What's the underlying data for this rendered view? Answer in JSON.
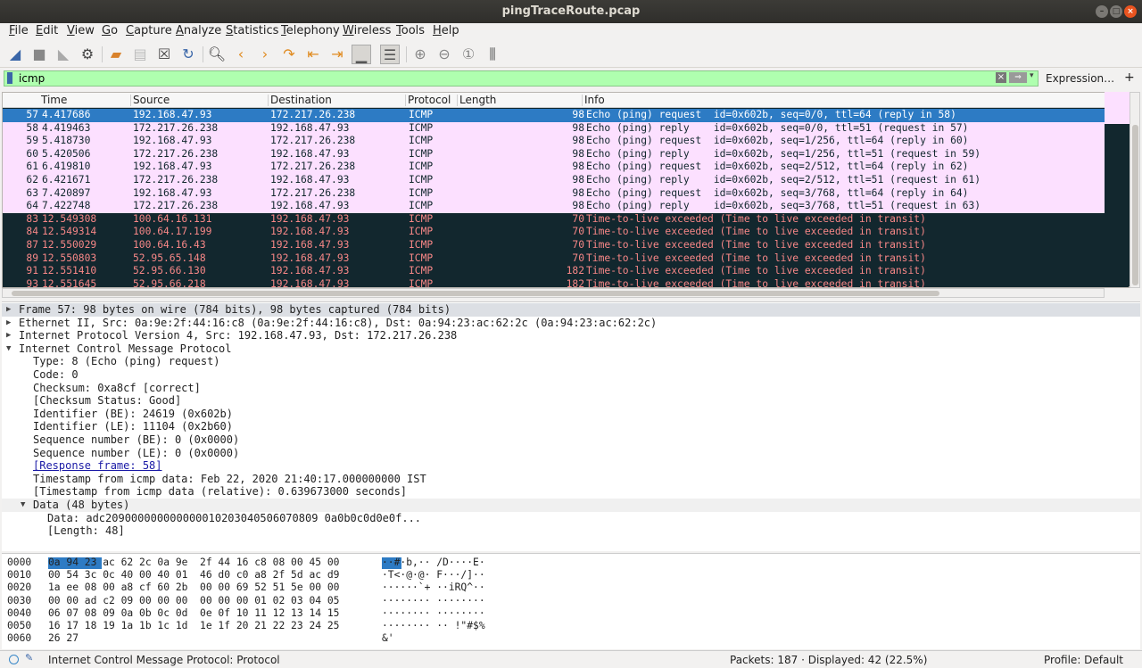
{
  "window": {
    "title": "pingTraceRoute.pcap"
  },
  "menu": [
    "File",
    "Edit",
    "View",
    "Go",
    "Capture",
    "Analyze",
    "Statistics",
    "Telephony",
    "Wireless",
    "Tools",
    "Help"
  ],
  "filter": {
    "value": "icmp",
    "expression_label": "Expression…",
    "add_label": "+"
  },
  "columns": [
    "Time",
    "Source",
    "Destination",
    "Protocol",
    "Length",
    "Info"
  ],
  "packets": [
    {
      "no": "57",
      "time": "4.417686",
      "src": "192.168.47.93",
      "dst": "172.217.26.238",
      "proto": "ICMP",
      "len": "98",
      "info": "Echo (ping) request  id=0x602b, seq=0/0, ttl=64 (reply in 58)",
      "style": "sel"
    },
    {
      "no": "58",
      "time": "4.419463",
      "src": "172.217.26.238",
      "dst": "192.168.47.93",
      "proto": "ICMP",
      "len": "98",
      "info": "Echo (ping) reply    id=0x602b, seq=0/0, ttl=51 (request in 57)",
      "style": "pink"
    },
    {
      "no": "59",
      "time": "5.418730",
      "src": "192.168.47.93",
      "dst": "172.217.26.238",
      "proto": "ICMP",
      "len": "98",
      "info": "Echo (ping) request  id=0x602b, seq=1/256, ttl=64 (reply in 60)",
      "style": "pink"
    },
    {
      "no": "60",
      "time": "5.420506",
      "src": "172.217.26.238",
      "dst": "192.168.47.93",
      "proto": "ICMP",
      "len": "98",
      "info": "Echo (ping) reply    id=0x602b, seq=1/256, ttl=51 (request in 59)",
      "style": "pink"
    },
    {
      "no": "61",
      "time": "6.419810",
      "src": "192.168.47.93",
      "dst": "172.217.26.238",
      "proto": "ICMP",
      "len": "98",
      "info": "Echo (ping) request  id=0x602b, seq=2/512, ttl=64 (reply in 62)",
      "style": "pink"
    },
    {
      "no": "62",
      "time": "6.421671",
      "src": "172.217.26.238",
      "dst": "192.168.47.93",
      "proto": "ICMP",
      "len": "98",
      "info": "Echo (ping) reply    id=0x602b, seq=2/512, ttl=51 (request in 61)",
      "style": "pink"
    },
    {
      "no": "63",
      "time": "7.420897",
      "src": "192.168.47.93",
      "dst": "172.217.26.238",
      "proto": "ICMP",
      "len": "98",
      "info": "Echo (ping) request  id=0x602b, seq=3/768, ttl=64 (reply in 64)",
      "style": "pink"
    },
    {
      "no": "64",
      "time": "7.422748",
      "src": "172.217.26.238",
      "dst": "192.168.47.93",
      "proto": "ICMP",
      "len": "98",
      "info": "Echo (ping) reply    id=0x602b, seq=3/768, ttl=51 (request in 63)",
      "style": "pink"
    },
    {
      "no": "83",
      "time": "12.549308",
      "src": "100.64.16.131",
      "dst": "192.168.47.93",
      "proto": "ICMP",
      "len": "70",
      "info": "Time-to-live exceeded (Time to live exceeded in transit)",
      "style": "dark"
    },
    {
      "no": "84",
      "time": "12.549314",
      "src": "100.64.17.199",
      "dst": "192.168.47.93",
      "proto": "ICMP",
      "len": "70",
      "info": "Time-to-live exceeded (Time to live exceeded in transit)",
      "style": "dark"
    },
    {
      "no": "87",
      "time": "12.550029",
      "src": "100.64.16.43",
      "dst": "192.168.47.93",
      "proto": "ICMP",
      "len": "70",
      "info": "Time-to-live exceeded (Time to live exceeded in transit)",
      "style": "dark"
    },
    {
      "no": "89",
      "time": "12.550803",
      "src": "52.95.65.148",
      "dst": "192.168.47.93",
      "proto": "ICMP",
      "len": "70",
      "info": "Time-to-live exceeded (Time to live exceeded in transit)",
      "style": "dark"
    },
    {
      "no": "91",
      "time": "12.551410",
      "src": "52.95.66.130",
      "dst": "192.168.47.93",
      "proto": "ICMP",
      "len": "182",
      "info": "Time-to-live exceeded (Time to live exceeded in transit)",
      "style": "dark"
    },
    {
      "no": "93",
      "time": "12.551645",
      "src": "52.95.66.218",
      "dst": "192.168.47.93",
      "proto": "ICMP",
      "len": "182",
      "info": "Time-to-live exceeded (Time to live exceeded in transit)",
      "style": "dark"
    }
  ],
  "details": [
    {
      "text": "Frame 57: 98 bytes on wire (784 bits), 98 bytes captured (784 bits)",
      "arrow": "right",
      "indent": 0,
      "hl": true
    },
    {
      "text": "Ethernet II, Src: 0a:9e:2f:44:16:c8 (0a:9e:2f:44:16:c8), Dst: 0a:94:23:ac:62:2c (0a:94:23:ac:62:2c)",
      "arrow": "right",
      "indent": 0
    },
    {
      "text": "Internet Protocol Version 4, Src: 192.168.47.93, Dst: 172.217.26.238",
      "arrow": "right",
      "indent": 0
    },
    {
      "text": "Internet Control Message Protocol",
      "arrow": "down",
      "indent": 0
    },
    {
      "text": "Type: 8 (Echo (ping) request)",
      "indent": 1
    },
    {
      "text": "Code: 0",
      "indent": 1
    },
    {
      "text": "Checksum: 0xa8cf [correct]",
      "indent": 1
    },
    {
      "text": "[Checksum Status: Good]",
      "indent": 1
    },
    {
      "text": "Identifier (BE): 24619 (0x602b)",
      "indent": 1
    },
    {
      "text": "Identifier (LE): 11104 (0x2b60)",
      "indent": 1
    },
    {
      "text": "Sequence number (BE): 0 (0x0000)",
      "indent": 1
    },
    {
      "text": "Sequence number (LE): 0 (0x0000)",
      "indent": 1
    },
    {
      "text": "[Response frame: 58]",
      "indent": 1,
      "link": true
    },
    {
      "text": "Timestamp from icmp data: Feb 22, 2020 21:40:17.000000000 IST",
      "indent": 1
    },
    {
      "text": "[Timestamp from icmp data (relative): 0.639673000 seconds]",
      "indent": 1
    },
    {
      "text": "Data (48 bytes)",
      "arrow": "down",
      "indent": 1,
      "hl2": true
    },
    {
      "text": "Data: adc209000000000000010203040506070809 0a0b0c0d0e0f...",
      "indent": 2
    },
    {
      "text": "[Length: 48]",
      "indent": 2
    }
  ],
  "bytes": [
    {
      "off": "0000",
      "hex": "0a 94 23 ac 62 2c 0a 9e  2f 44 16 c8 08 00 45 00",
      "ascii": "··#·b,·· /D····E·"
    },
    {
      "off": "0010",
      "hex": "00 54 3c 0c 40 00 40 01  46 d0 c0 a8 2f 5d ac d9",
      "ascii": "·T<·@·@· F···/]··"
    },
    {
      "off": "0020",
      "hex": "1a ee 08 00 a8 cf 60 2b  00 00 69 52 51 5e 00 00",
      "ascii": "······`+ ··iRQ^··"
    },
    {
      "off": "0030",
      "hex": "00 00 ad c2 09 00 00 00  00 00 00 01 02 03 04 05",
      "ascii": "········ ········"
    },
    {
      "off": "0040",
      "hex": "06 07 08 09 0a 0b 0c 0d  0e 0f 10 11 12 13 14 15",
      "ascii": "········ ········"
    },
    {
      "off": "0050",
      "hex": "16 17 18 19 1a 1b 1c 1d  1e 1f 20 21 22 23 24 25",
      "ascii": "········ ·· !\"#$%"
    },
    {
      "off": "0060",
      "hex": "26 27",
      "ascii": "&'"
    }
  ],
  "status": {
    "left": "Internet Control Message Protocol: Protocol",
    "packets": "Packets: 187 · Displayed: 42 (22.5%)",
    "profile": "Profile: Default"
  },
  "colors": {
    "selected": "#2d7bc4",
    "icmp_pink": "#fce0ff",
    "ttl_dark": "#12272e",
    "ttl_text": "#f78787",
    "filter_ok": "#afffaf"
  }
}
